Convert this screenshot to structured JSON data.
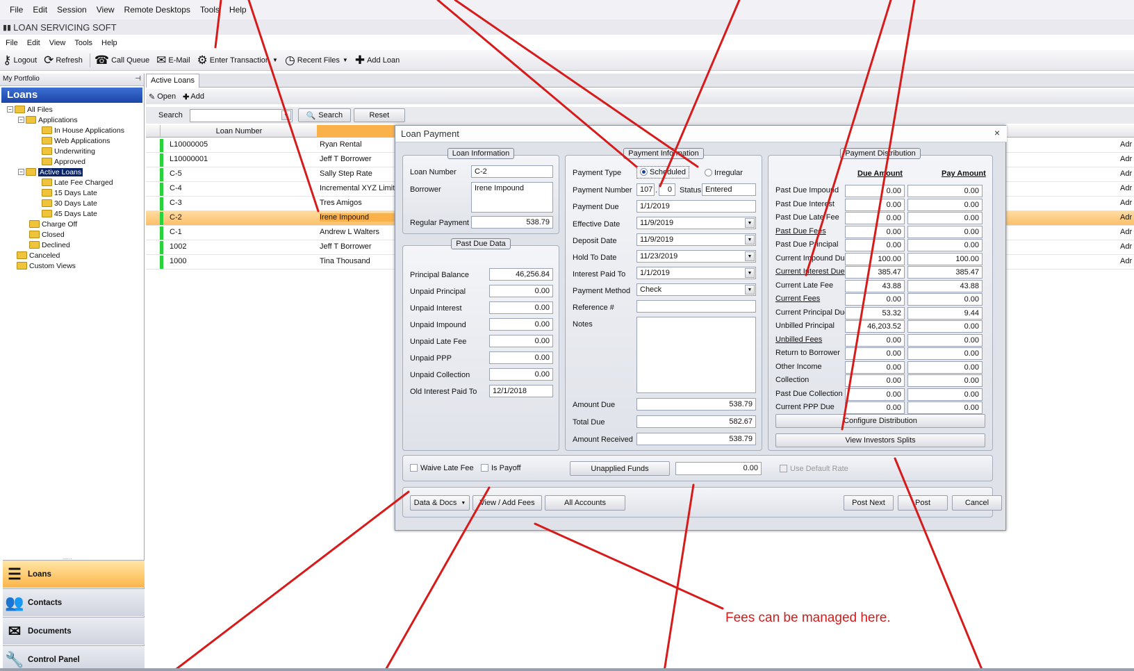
{
  "menu": {
    "items": [
      "File",
      "Edit",
      "Session",
      "View",
      "Remote Desktops",
      "Tools",
      "Help"
    ]
  },
  "app": {
    "title": "LOAN SERVICING SOFT"
  },
  "appmenu": {
    "items": [
      "File",
      "Edit",
      "View",
      "Tools",
      "Help"
    ]
  },
  "toolbar": {
    "logout": "Logout",
    "refresh": "Refresh",
    "call_queue": "Call Queue",
    "email": "E-Mail",
    "enter_transaction": "Enter Transaction",
    "recent_files": "Recent Files",
    "add_loan": "Add Loan"
  },
  "sidebar": {
    "portfolio_title": "My Portfolio",
    "header": "Loans",
    "tree": [
      "All Files",
      "Applications",
      "In House Applications",
      "Web Applications",
      "Underwriting",
      "Approved",
      "Active Loans",
      "Late Fee Charged",
      "15 Days Late",
      "30 Days Late",
      "45 Days Late",
      "Charge Off",
      "Closed",
      "Declined",
      "Canceled",
      "Custom Views"
    ],
    "nav": [
      "Loans",
      "Contacts",
      "Documents",
      "Control Panel"
    ]
  },
  "main": {
    "tab": "Active Loans",
    "open": "Open",
    "add": "Add",
    "search_label": "Search",
    "search_btn": "Search",
    "reset_btn": "Reset",
    "col_loan_number": "Loan Number",
    "rows": [
      {
        "loan": "L10000005",
        "name": "Ryan Rental"
      },
      {
        "loan": "L10000001",
        "name": "Jeff T Borrower"
      },
      {
        "loan": "C-5",
        "name": "Sally Step Rate"
      },
      {
        "loan": "C-4",
        "name": "Incremental XYZ Limited"
      },
      {
        "loan": "C-3",
        "name": "Tres Amigos"
      },
      {
        "loan": "C-2",
        "name": "Irene Impound"
      },
      {
        "loan": "C-1",
        "name": "Andrew L Walters"
      },
      {
        "loan": "1002",
        "name": "Jeff T Borrower"
      },
      {
        "loan": "1000",
        "name": "Tina Thousand"
      }
    ],
    "right_col": "Adr"
  },
  "dialog": {
    "title": "Loan Payment",
    "close": "×",
    "loan_info": {
      "title": "Loan Information",
      "loan_number_label": "Loan Number",
      "loan_number": "C-2",
      "borrower_label": "Borrower",
      "borrower": "Irene Impound",
      "regular_payment_label": "Regular Payment",
      "regular_payment": "538.79"
    },
    "past_due": {
      "title": "Past Due Data",
      "rows": [
        {
          "label": "Principal Balance",
          "value": "46,256.84"
        },
        {
          "label": "Unpaid Principal",
          "value": "0.00"
        },
        {
          "label": "Unpaid Interest",
          "value": "0.00"
        },
        {
          "label": "Unpaid Impound",
          "value": "0.00"
        },
        {
          "label": "Unpaid Late Fee",
          "value": "0.00"
        },
        {
          "label": "Unpaid PPP",
          "value": "0.00"
        },
        {
          "label": "Unpaid Collection",
          "value": "0.00"
        },
        {
          "label": "Old Interest Paid To",
          "value": "12/1/2018"
        }
      ]
    },
    "payment_info": {
      "title": "Payment Information",
      "payment_type_label": "Payment Type",
      "scheduled": "Scheduled",
      "irregular": "Irregular",
      "payment_number_label": "Payment Number",
      "payment_number_a": "107",
      "payment_number_b": "0",
      "status_label": "Status",
      "status": "Entered",
      "payment_due_label": "Payment Due",
      "payment_due": "1/1/2019",
      "effective_date_label": "Effective Date",
      "effective_date": "11/9/2019",
      "deposit_date_label": "Deposit Date",
      "deposit_date": "11/9/2019",
      "hold_to_date_label": "Hold To Date",
      "hold_to_date": "11/23/2019",
      "interest_paid_to_label": "Interest Paid To",
      "interest_paid_to": "1/1/2019",
      "payment_method_label": "Payment Method",
      "payment_method": "Check",
      "reference_label": "Reference #",
      "reference": "",
      "notes_label": "Notes",
      "amount_due_label": "Amount Due",
      "amount_due": "538.79",
      "total_due_label": "Total Due",
      "total_due": "582.67",
      "amount_received_label": "Amount Received",
      "amount_received": "538.79"
    },
    "distribution": {
      "title": "Payment Distribution",
      "due_header": "Due Amount",
      "pay_header": "Pay Amount",
      "rows": [
        {
          "label": "Past Due Impound",
          "due": "0.00",
          "pay": "0.00",
          "link": false
        },
        {
          "label": "Past Due Interest",
          "due": "0.00",
          "pay": "0.00",
          "link": false
        },
        {
          "label": "Past Due Late Fee",
          "due": "0.00",
          "pay": "0.00",
          "link": false
        },
        {
          "label": "Past Due Fees",
          "due": "0.00",
          "pay": "0.00",
          "link": true
        },
        {
          "label": "Past Due Principal",
          "due": "0.00",
          "pay": "0.00",
          "link": false
        },
        {
          "label": "Current Impound Due",
          "due": "100.00",
          "pay": "100.00",
          "link": false
        },
        {
          "label": "Current Interest Due",
          "due": "385.47",
          "pay": "385.47",
          "link": true
        },
        {
          "label": "Current Late Fee",
          "due": "43.88",
          "pay": "43.88",
          "link": false
        },
        {
          "label": "Current Fees",
          "due": "0.00",
          "pay": "0.00",
          "link": true
        },
        {
          "label": "Current Principal Due",
          "due": "53.32",
          "pay": "9.44",
          "link": false
        },
        {
          "label": "Unbilled Principal",
          "due": "46,203.52",
          "pay": "0.00",
          "link": false
        },
        {
          "label": "Unbilled Fees",
          "due": "0.00",
          "pay": "0.00",
          "link": true
        },
        {
          "label": "Return to Borrower",
          "due": "0.00",
          "pay": "0.00",
          "link": false
        },
        {
          "label": "Other Income",
          "due": "0.00",
          "pay": "0.00",
          "link": false
        },
        {
          "label": "Collection",
          "due": "0.00",
          "pay": "0.00",
          "link": false
        },
        {
          "label": "Past Due Collection",
          "due": "0.00",
          "pay": "0.00",
          "link": false
        },
        {
          "label": "Current PPP Due",
          "due": "0.00",
          "pay": "0.00",
          "link": false
        }
      ],
      "configure_btn": "Configure Distribution",
      "investors_btn": "View Investors Splits"
    },
    "options": {
      "waive_late_fee": "Waive Late Fee",
      "is_payoff": "Is Payoff",
      "unapplied_funds_btn": "Unapplied Funds",
      "unapplied_value": "0.00",
      "use_default_rate": "Use Default Rate"
    },
    "footer": {
      "data_docs": "Data & Docs",
      "view_add_fees": "View / Add Fees",
      "all_accounts": "All Accounts",
      "post_next": "Post Next",
      "post": "Post",
      "cancel": "Cancel"
    }
  },
  "annotation": {
    "text": "Fees can be managed here.",
    "color": "#d71a1a"
  }
}
